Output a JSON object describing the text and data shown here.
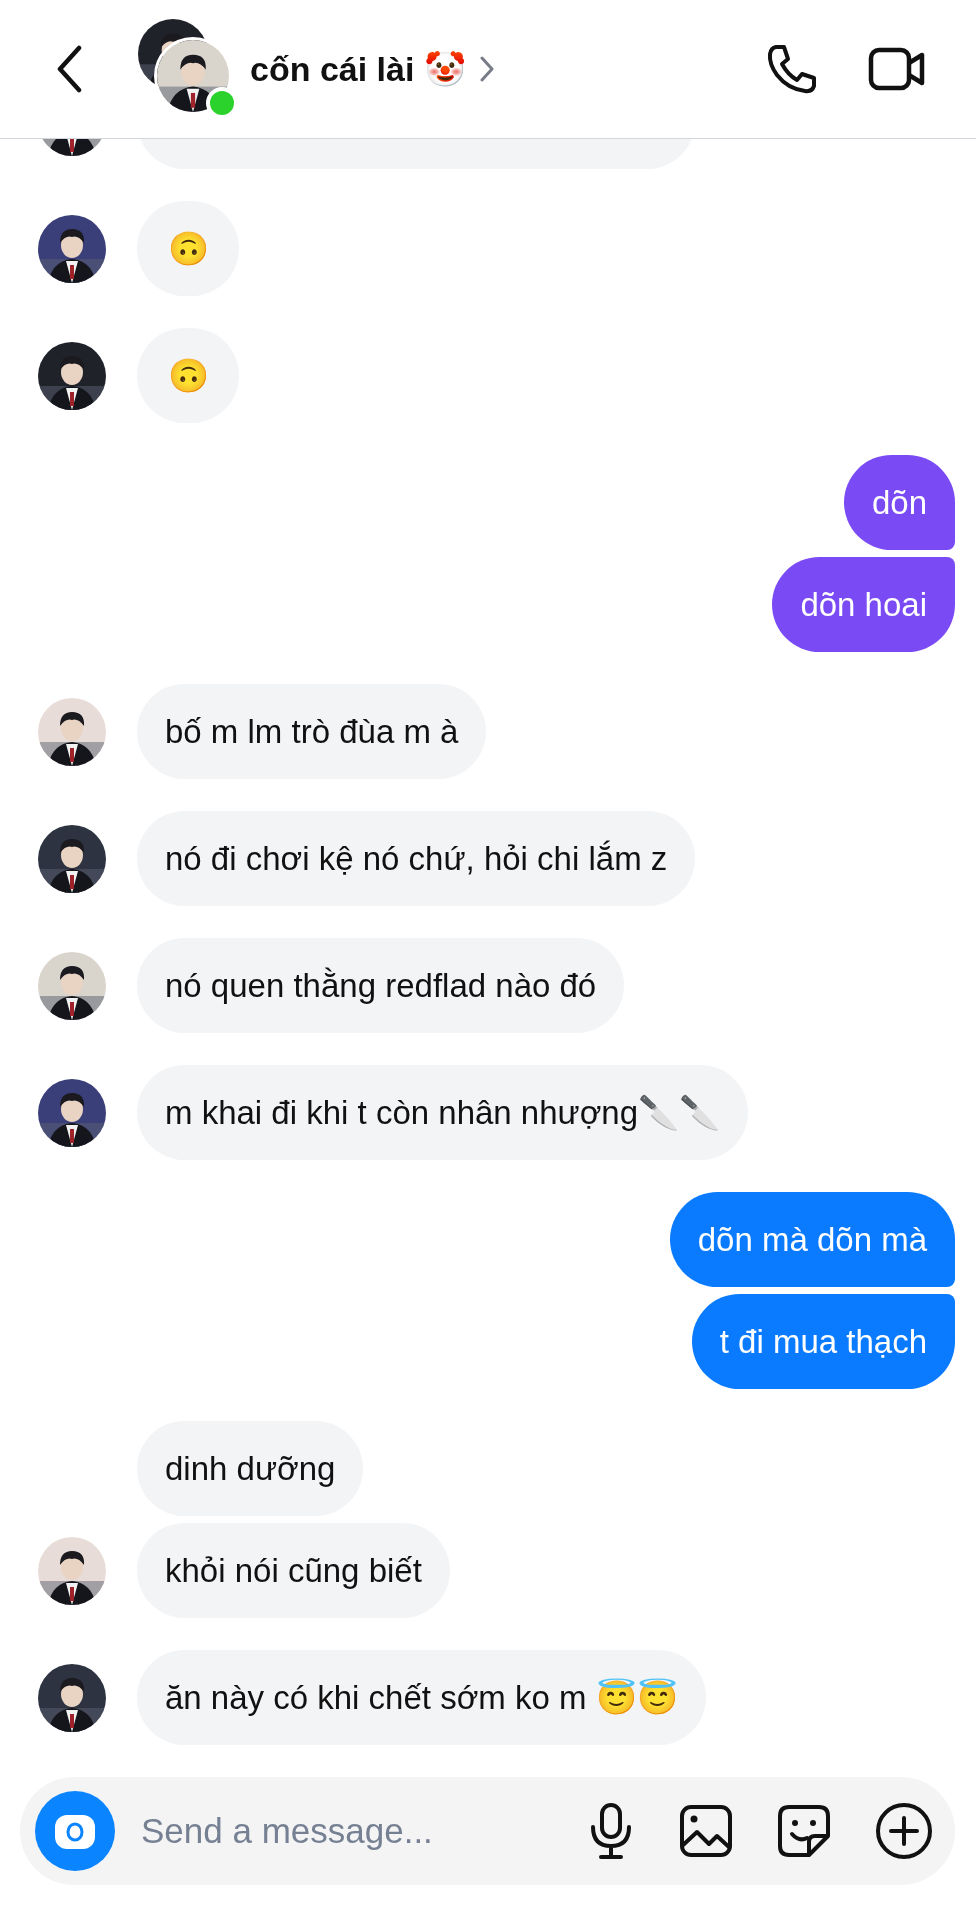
{
  "header": {
    "name": "cốn cái lài 🤡",
    "online": true
  },
  "groups": [
    {
      "kind": "incoming",
      "avatar": {
        "kind": "picture"
      },
      "messages": [
        {
          "kind": "cut"
        }
      ]
    },
    {
      "kind": "incoming",
      "avatar": {
        "kind": "picture"
      },
      "messages": [
        {
          "kind": "emoji",
          "text": "🙃"
        }
      ]
    },
    {
      "kind": "incoming",
      "avatar": {
        "kind": "picture"
      },
      "messages": [
        {
          "kind": "emoji",
          "text": "🙃"
        }
      ]
    },
    {
      "kind": "outgoing",
      "color": "#7a4bf5",
      "messages": [
        {
          "kind": "text",
          "text": "dõn"
        },
        {
          "kind": "text",
          "text": "dõn hoai"
        }
      ]
    },
    {
      "kind": "incoming",
      "avatar": {
        "kind": "picture"
      },
      "messages": [
        {
          "kind": "text",
          "text": "bố m lm trò đùa m à"
        }
      ]
    },
    {
      "kind": "incoming",
      "avatar": {
        "kind": "picture"
      },
      "messages": [
        {
          "kind": "text",
          "text": "nó đi chơi kệ nó chứ, hỏi chi lắm z"
        }
      ]
    },
    {
      "kind": "incoming",
      "avatar": {
        "kind": "picture"
      },
      "messages": [
        {
          "kind": "text",
          "text": "nó quen thằng redflad nào đó"
        }
      ]
    },
    {
      "kind": "incoming",
      "avatar": {
        "kind": "picture"
      },
      "messages": [
        {
          "kind": "text",
          "text": "m khai đi khi t còn nhân nhượng🔪🔪"
        }
      ]
    },
    {
      "kind": "outgoing",
      "color": "#0a7bff",
      "messages": [
        {
          "kind": "text",
          "text": "dõn mà dõn mà"
        },
        {
          "kind": "text",
          "text": "t đi mua thạch"
        }
      ]
    },
    {
      "kind": "incoming",
      "avatar": {
        "kind": "picture"
      },
      "messages": [
        {
          "kind": "text",
          "text": "dinh dưỡng"
        },
        {
          "kind": "text",
          "text": "khỏi nói cũng biết"
        }
      ]
    },
    {
      "kind": "incoming",
      "avatar": {
        "kind": "picture"
      },
      "messages": [
        {
          "kind": "text",
          "text": "ăn này có khi chết sớm ko m 😇😇"
        }
      ]
    }
  ],
  "composer": {
    "placeholder": "Send a message..."
  }
}
